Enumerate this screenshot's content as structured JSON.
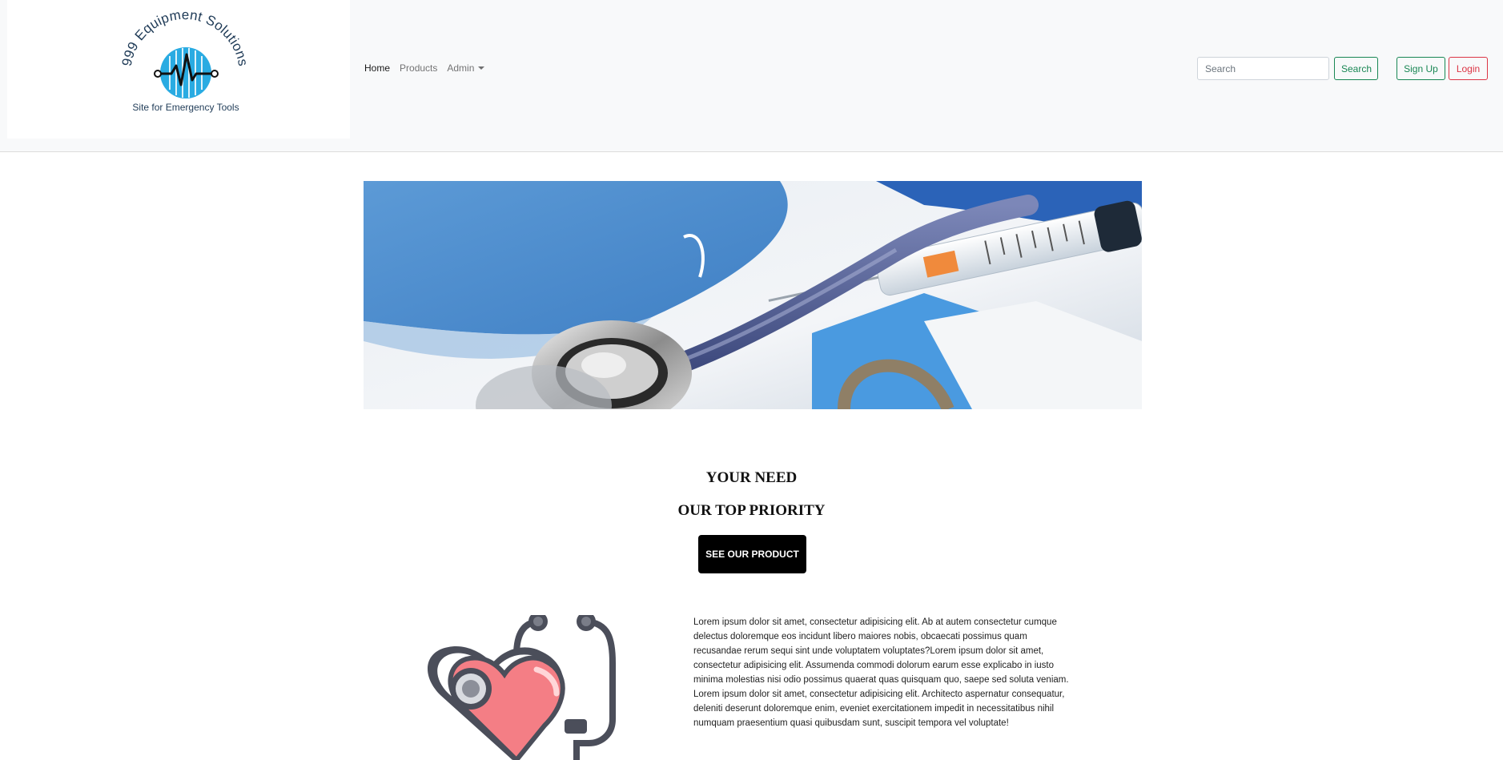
{
  "logo": {
    "brand_name": "999 Equipment Solutions",
    "tagline": "Site for Emergency Tools",
    "icon": "heartbeat-circuit-logo"
  },
  "nav": {
    "items": [
      {
        "label": "Home",
        "active": true
      },
      {
        "label": "Products",
        "active": false
      },
      {
        "label": "Admin",
        "active": false,
        "dropdown": true
      }
    ]
  },
  "search": {
    "placeholder": "Search",
    "button_label": "Search"
  },
  "auth": {
    "signup_label": "Sign Up",
    "login_label": "Login"
  },
  "hero": {
    "image": "medical-equipment-banner"
  },
  "tagline": {
    "line1": "YOUR NEED",
    "line2": "OUR TOP PRIORITY",
    "cta_label": "SEE OUR PRODUCT"
  },
  "about": {
    "illustration": "heart-stethoscope-icon",
    "text": "Lorem ipsum dolor sit amet, consectetur adipisicing elit. Ab at autem consectetur cumque delectus doloremque eos incidunt libero maiores nobis, obcaecati possimus quam recusandae rerum sequi sint unde voluptatem voluptates?Lorem ipsum dolor sit amet, consectetur adipisicing elit. Assumenda commodi dolorum earum esse explicabo in iusto minima molestias nisi odio possimus quaerat quas quisquam quo, saepe sed soluta veniam. Lorem ipsum dolor sit amet, consectetur adipisicing elit. Architecto aspernatur consequatur, deleniti deserunt doloremque enim, eveniet exercitationem impedit in necessitatibus nihil numquam praesentium quasi quibusdam sunt, suscipit tempora vel voluptate!"
  },
  "colors": {
    "navbar_bg": "#f8f9fa",
    "success": "#198754",
    "danger": "#dc3545",
    "cta_bg": "#000000",
    "logo_blue": "#29abe2",
    "logo_text": "#1f3b57"
  }
}
